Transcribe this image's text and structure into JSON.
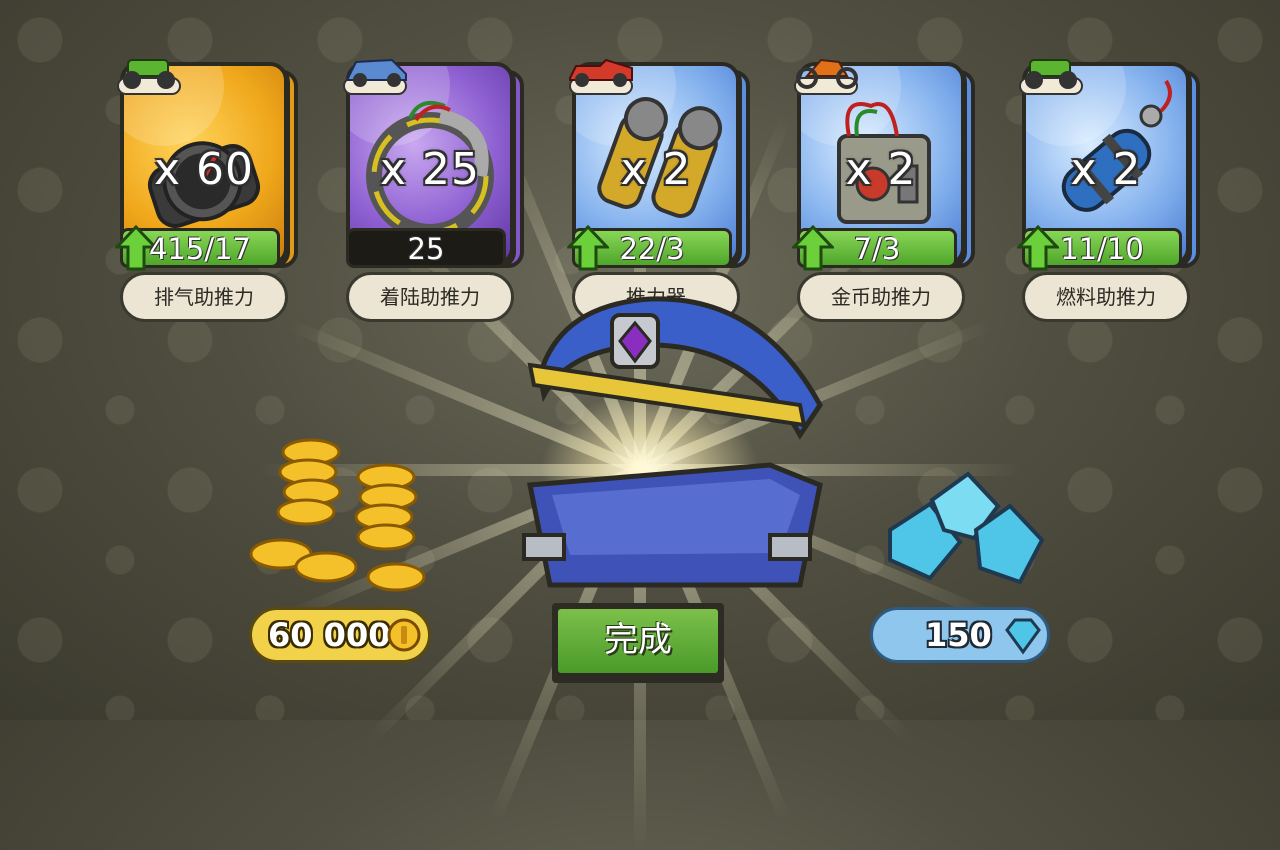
{
  "cards": [
    {
      "theme": "gold",
      "quantity": "x 60",
      "progress": "415/17",
      "progress_style": "upgrade",
      "label": "排气助推力",
      "vehicle_icon": "green-buggy-icon",
      "item_icon": "exhaust-booster-icon"
    },
    {
      "theme": "purple",
      "quantity": "x 25",
      "progress": "25",
      "progress_style": "plain",
      "label": "着陆助推力",
      "vehicle_icon": "blue-minicar-icon",
      "item_icon": "landing-booster-icon"
    },
    {
      "theme": "blue",
      "quantity": "x 2",
      "progress": "22/3",
      "progress_style": "upgrade",
      "label": "推力器",
      "vehicle_icon": "red-convertible-icon",
      "item_icon": "thruster-icon"
    },
    {
      "theme": "blue",
      "quantity": "x 2",
      "progress": "7/3",
      "progress_style": "upgrade",
      "label": "金币助推力",
      "vehicle_icon": "motocross-bike-icon",
      "item_icon": "coin-booster-icon"
    },
    {
      "theme": "blue",
      "quantity": "x 2",
      "progress": "11/10",
      "progress_style": "upgrade",
      "label": "燃料助推力",
      "vehicle_icon": "green-buggy-icon",
      "item_icon": "fuel-booster-icon"
    }
  ],
  "rewards": {
    "coins": "60 000",
    "gems": "150"
  },
  "done_button": "完成",
  "colors": {
    "upgrade_green": "#5bb531",
    "coin_gold": "#f2d24a",
    "gem_blue": "#8fc6ee"
  }
}
